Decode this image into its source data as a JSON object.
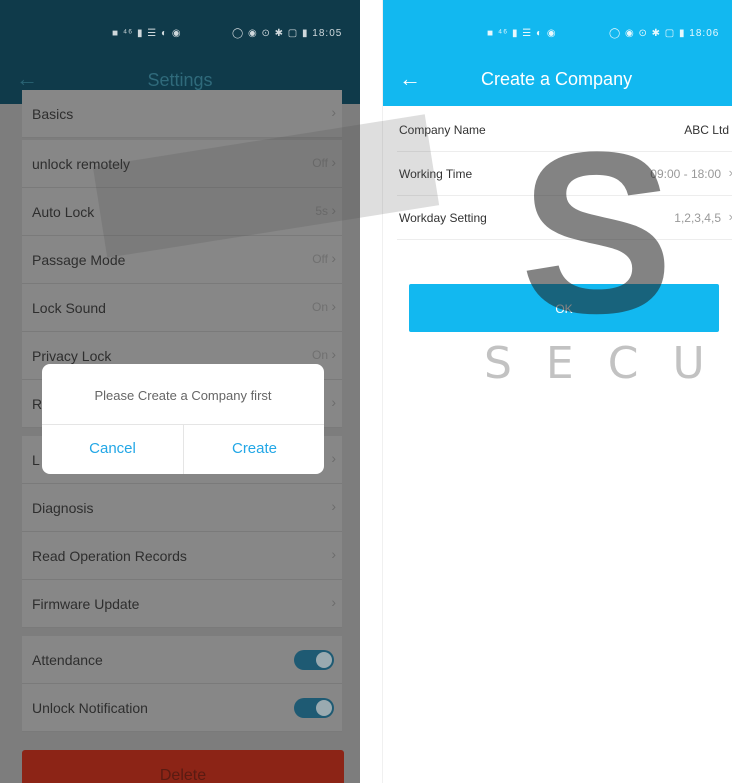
{
  "left": {
    "status_bar": {
      "icons_mid": "■ ⁴⁶ ▮ ☰ ◐ ◉",
      "icons_right": "◯ ◉ ⊙ ✱ ▢ ▮ 18:05"
    },
    "title": "Settings",
    "rows": [
      {
        "label": "Basics",
        "value": ""
      },
      {
        "label": "unlock remotely",
        "value": "Off"
      },
      {
        "label": "Auto Lock",
        "value": "5s"
      },
      {
        "label": "Passage Mode",
        "value": "Off"
      },
      {
        "label": "Lock Sound",
        "value": "On"
      },
      {
        "label": "Privacy Lock",
        "value": "On"
      },
      {
        "label": "R",
        "value": ""
      },
      {
        "label": "L",
        "value": ""
      },
      {
        "label": "Diagnosis",
        "value": ""
      },
      {
        "label": "Read Operation Records",
        "value": ""
      },
      {
        "label": "Firmware Update",
        "value": ""
      },
      {
        "label": "Attendance",
        "toggle": true
      },
      {
        "label": "Unlock Notification",
        "toggle": true
      }
    ],
    "delete_label": "Delete",
    "dialog": {
      "message": "Please Create a Company first",
      "cancel_label": "Cancel",
      "create_label": "Create"
    }
  },
  "right": {
    "status_bar": {
      "icons_mid": "■ ⁴⁶ ▮ ☰ ◐ ◉",
      "icons_right": "◯ ◉ ⊙ ✱ ▢ ▮ 18:06"
    },
    "title": "Create a Company",
    "rows": [
      {
        "label": "Company Name",
        "value": "ABC Ltd"
      },
      {
        "label": "Working Time",
        "value": "09:00 - 18:00"
      },
      {
        "label": "Workday Setting",
        "value": "1,2,3,4,5"
      }
    ],
    "ok_label": "OK"
  },
  "watermark": {
    "letter": "S",
    "text": "SECU"
  },
  "colors": {
    "accent": "#12b8f0",
    "dialog_button": "#23a7e6",
    "delete": "#8c2416"
  }
}
